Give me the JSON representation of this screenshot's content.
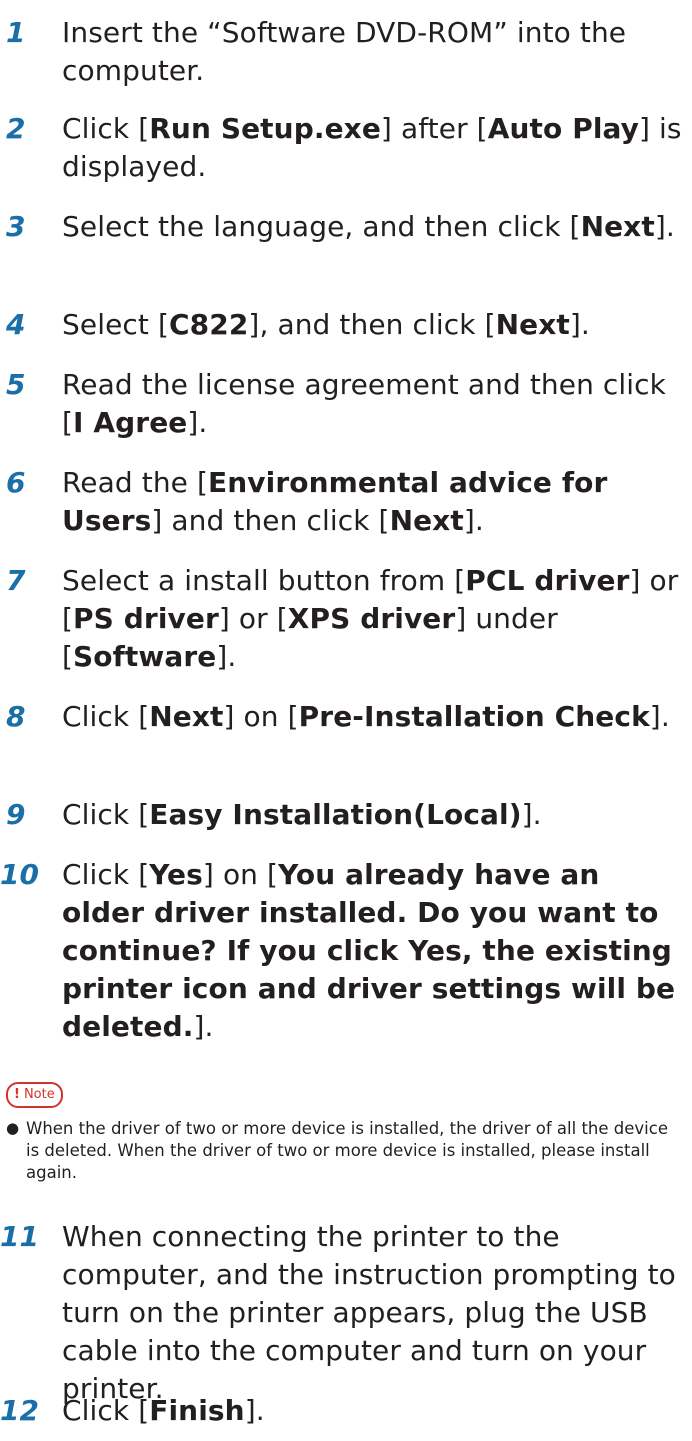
{
  "steps": [
    {
      "num": "1",
      "parts": [
        [
          "Insert the “Software DVD-ROM” into the computer.",
          false
        ]
      ]
    },
    {
      "num": "2",
      "parts": [
        [
          "Click [",
          false
        ],
        [
          "Run Setup.exe",
          true
        ],
        [
          "] after [",
          false
        ],
        [
          "Auto Play",
          true
        ],
        [
          "] is displayed.",
          false
        ]
      ]
    },
    {
      "num": "3",
      "parts": [
        [
          "Select the language, and then click [",
          false
        ],
        [
          "Next",
          true
        ],
        [
          "].",
          false
        ]
      ]
    },
    {
      "num": "4",
      "parts": [
        [
          "Select [",
          false
        ],
        [
          "C822",
          true
        ],
        [
          "], and then click [",
          false
        ],
        [
          "Next",
          true
        ],
        [
          "].",
          false
        ]
      ]
    },
    {
      "num": "5",
      "parts": [
        [
          "Read the license agreement and then click [",
          false
        ],
        [
          "I Agree",
          true
        ],
        [
          "].",
          false
        ]
      ]
    },
    {
      "num": "6",
      "parts": [
        [
          "Read the [",
          false
        ],
        [
          "Environmental advice for Users",
          true
        ],
        [
          "] and then click [",
          false
        ],
        [
          "Next",
          true
        ],
        [
          "].",
          false
        ]
      ]
    },
    {
      "num": "7",
      "parts": [
        [
          "Select a install button from [",
          false
        ],
        [
          "PCL driver",
          true
        ],
        [
          "] or [",
          false
        ],
        [
          "PS driver",
          true
        ],
        [
          "] or [",
          false
        ],
        [
          "XPS driver",
          true
        ],
        [
          "] under [",
          false
        ],
        [
          "Software",
          true
        ],
        [
          "].",
          false
        ]
      ]
    },
    {
      "num": "8",
      "parts": [
        [
          "Click [",
          false
        ],
        [
          "Next",
          true
        ],
        [
          "] on [",
          false
        ],
        [
          "Pre-Installation Check",
          true
        ],
        [
          "].",
          false
        ]
      ]
    },
    {
      "num": "9",
      "parts": [
        [
          "Click [",
          false
        ],
        [
          "Easy Installation(Local)",
          true
        ],
        [
          "].",
          false
        ]
      ]
    },
    {
      "num": "10",
      "parts": [
        [
          "Click [",
          false
        ],
        [
          "Yes",
          true
        ],
        [
          "] on [",
          false
        ],
        [
          "You already have an older driver installed. Do you want to continue? If you click Yes, the existing printer icon and driver settings will be deleted.",
          true
        ],
        [
          "].",
          false
        ]
      ]
    },
    {
      "num": "11",
      "parts": [
        [
          "When connecting the printer to the computer, and the instruction prompting to turn on the printer appears, plug the USB cable into the computer and turn on your printer.",
          false
        ]
      ]
    },
    {
      "num": "12",
      "parts": [
        [
          "Click [",
          false
        ],
        [
          "Finish",
          true
        ],
        [
          "].",
          false
        ]
      ]
    }
  ],
  "note": {
    "label": "Note",
    "mark": "!",
    "bullet": "●",
    "text": "When the driver of two or more device is installed, the driver of all the device is deleted. When the driver of two or more device is installed, please install again."
  }
}
